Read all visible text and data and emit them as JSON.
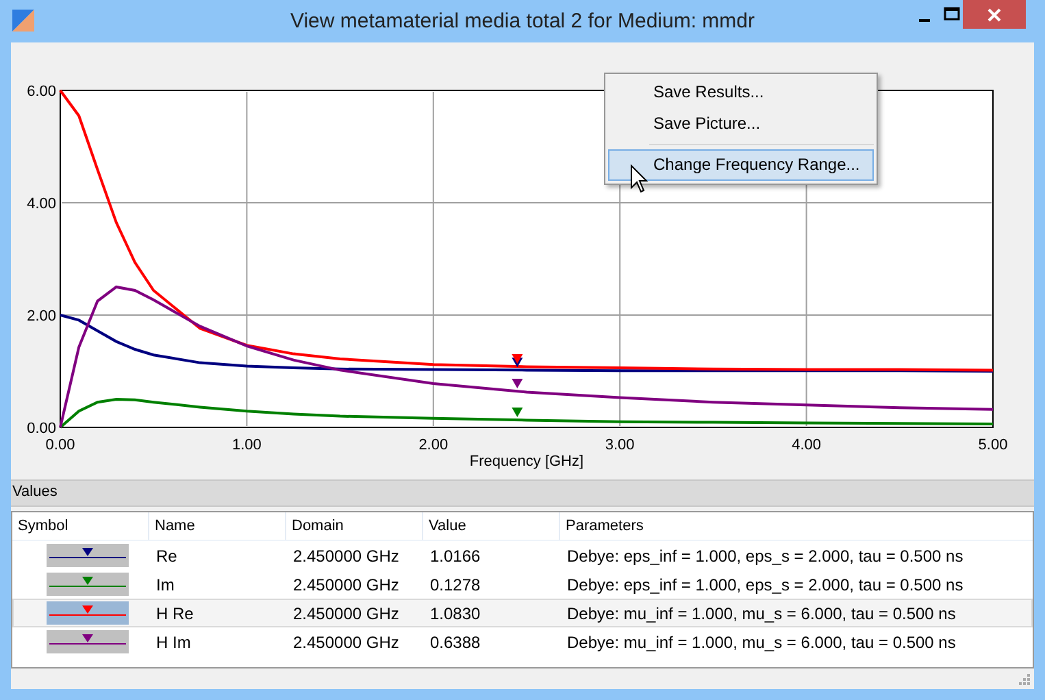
{
  "window": {
    "title": "View metamaterial media total 2 for Medium: mmdr"
  },
  "chart": {
    "chart_data": {
      "type": "line",
      "grid": true,
      "xlabel": "Frequency [GHz]",
      "xlim": [
        0,
        5
      ],
      "ylim": [
        0,
        6
      ],
      "xticks": [
        {
          "value": 0,
          "label": "0.00"
        },
        {
          "value": 1,
          "label": "1.00"
        },
        {
          "value": 2,
          "label": "2.00"
        },
        {
          "value": 3,
          "label": "3.00"
        },
        {
          "value": 4,
          "label": "4.00"
        },
        {
          "value": 5,
          "label": "5.00"
        }
      ],
      "yticks": [
        {
          "value": 0,
          "label": "0.00"
        },
        {
          "value": 2,
          "label": "2.00"
        },
        {
          "value": 4,
          "label": "4.00"
        },
        {
          "value": 6,
          "label": "6.00"
        }
      ],
      "x": [
        0,
        0.1,
        0.2,
        0.3,
        0.4,
        0.5,
        0.75,
        1,
        1.25,
        1.5,
        2,
        2.5,
        3,
        3.5,
        4,
        4.5,
        5
      ],
      "series": [
        {
          "color": "#000080",
          "values": [
            2,
            1.91,
            1.72,
            1.53,
            1.39,
            1.29,
            1.15,
            1.09,
            1.06,
            1.04,
            1.03,
            1.02,
            1.01,
            1.01,
            1.01,
            1.01,
            1
          ]
        },
        {
          "color": "#008000",
          "values": [
            0,
            0.29,
            0.45,
            0.5,
            0.49,
            0.45,
            0.36,
            0.29,
            0.24,
            0.2,
            0.16,
            0.13,
            0.1,
            0.09,
            0.08,
            0.07,
            0.06
          ]
        },
        {
          "color": "#ff0000",
          "values": [
            6,
            5.55,
            4.59,
            3.65,
            2.94,
            2.44,
            1.76,
            1.46,
            1.31,
            1.22,
            1.12,
            1.08,
            1.06,
            1.04,
            1.03,
            1.03,
            1.02
          ]
        },
        {
          "color": "#800080",
          "values": [
            0,
            1.43,
            2.25,
            2.5,
            2.44,
            2.27,
            1.8,
            1.45,
            1.2,
            1.02,
            0.78,
            0.63,
            0.53,
            0.45,
            0.4,
            0.35,
            0.32
          ]
        }
      ]
    }
  },
  "context_menu": {
    "items": [
      {
        "kind": "item",
        "label": "Save Results...",
        "selected": false
      },
      {
        "kind": "item",
        "label": "Save Picture...",
        "selected": false
      },
      {
        "kind": "separator"
      },
      {
        "kind": "item",
        "label": "Change Frequency Range...",
        "selected": true
      }
    ]
  },
  "values_panel": {
    "title": "Values",
    "columns": [
      "Symbol",
      "Name",
      "Domain",
      "Value",
      "Parameters"
    ],
    "rows": [
      {
        "color": "#000080",
        "selected": false,
        "name": "Re",
        "domain": "2.450000 GHz",
        "value": "1.0166",
        "parameters": "Debye: eps_inf = 1.000, eps_s = 2.000, tau = 0.500 ns"
      },
      {
        "color": "#008000",
        "selected": false,
        "name": "Im",
        "domain": "2.450000 GHz",
        "value": "0.1278",
        "parameters": "Debye: eps_inf = 1.000, eps_s = 2.000, tau = 0.500 ns"
      },
      {
        "color": "#ff0000",
        "selected": true,
        "name": "H Re",
        "domain": "2.450000 GHz",
        "value": "1.0830",
        "parameters": "Debye: mu_inf = 1.000, mu_s = 6.000, tau = 0.500 ns"
      },
      {
        "color": "#800080",
        "selected": false,
        "name": "H Im",
        "domain": "2.450000 GHz",
        "value": "0.6388",
        "parameters": "Debye: mu_inf = 1.000, mu_s = 6.000, tau = 0.500 ns"
      }
    ]
  }
}
